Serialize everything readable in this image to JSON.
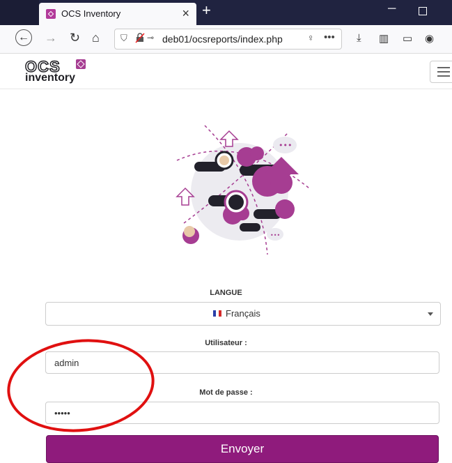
{
  "browser": {
    "tab_title": "OCS Inventory",
    "tab_close": "×",
    "new_tab": "+",
    "minimize": "─",
    "url": "deb01/ocsreports/index.php",
    "more": "•••"
  },
  "site": {
    "logo_top": "OCS",
    "logo_bottom": "inventory"
  },
  "form": {
    "language_label": "LANGUE",
    "language_value": "Français",
    "user_label": "Utilisateur :",
    "user_value": "admin",
    "password_label": "Mot de passe :",
    "password_value": "admin",
    "submit_label": "Envoyer"
  },
  "colors": {
    "accent": "#8f1b7c",
    "illustration_purple": "#a63d92",
    "annotation_red": "#e01010"
  },
  "icons": [
    "tab-favicon",
    "close-icon",
    "plus-icon",
    "back-icon",
    "forward-icon",
    "reload-icon",
    "home-icon",
    "shield-icon",
    "lock-icon",
    "key-icon",
    "bulb-icon",
    "download-icon",
    "library-icon",
    "sidebar-icon",
    "account-icon",
    "hamburger-icon"
  ]
}
